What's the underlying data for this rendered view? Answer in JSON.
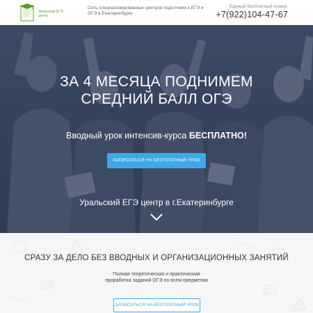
{
  "header": {
    "logo_text": "Уральский ЕГЭ центр",
    "tagline": "Сеть специализированных центров подготовки к ЕГЭ и ОГЭ в Екатеринбурге",
    "phone_caption": "Единый бесплатный номер:",
    "phone_number": "+7(922)104-47-67"
  },
  "hero": {
    "title_line1": "ЗА 4 МЕСЯЦА ПОДНИМЕМ",
    "title_line2": "СРЕДНИЙ БАЛЛ ОГЭ",
    "subtitle_prefix": "Вводный урок интенсив-курса ",
    "subtitle_strong": "БЕСПЛАТНО!",
    "cta_label": "Записаться на бесплатный урок",
    "center_name": "Уральский ЕГЭ центр в г.Екатеринбурге"
  },
  "section": {
    "title": "СРАЗУ ЗА ДЕЛО БЕЗ ВВОДНЫХ И ОРГАНИЗАЦИОННЫХ ЗАНЯТИЙ",
    "description": "Полная теоретическая и практическая проработка заданий ОГЭ по всем предметам",
    "cta_label": "Записаться на бесплатный урок"
  },
  "colors": {
    "accent": "#3fa8e6",
    "brand_green": "#5a9a2e",
    "hero_overlay": "#28344b"
  },
  "icons": {
    "logo": "graduation-cap-book-logo",
    "scroll": "chevron-down-icon"
  }
}
